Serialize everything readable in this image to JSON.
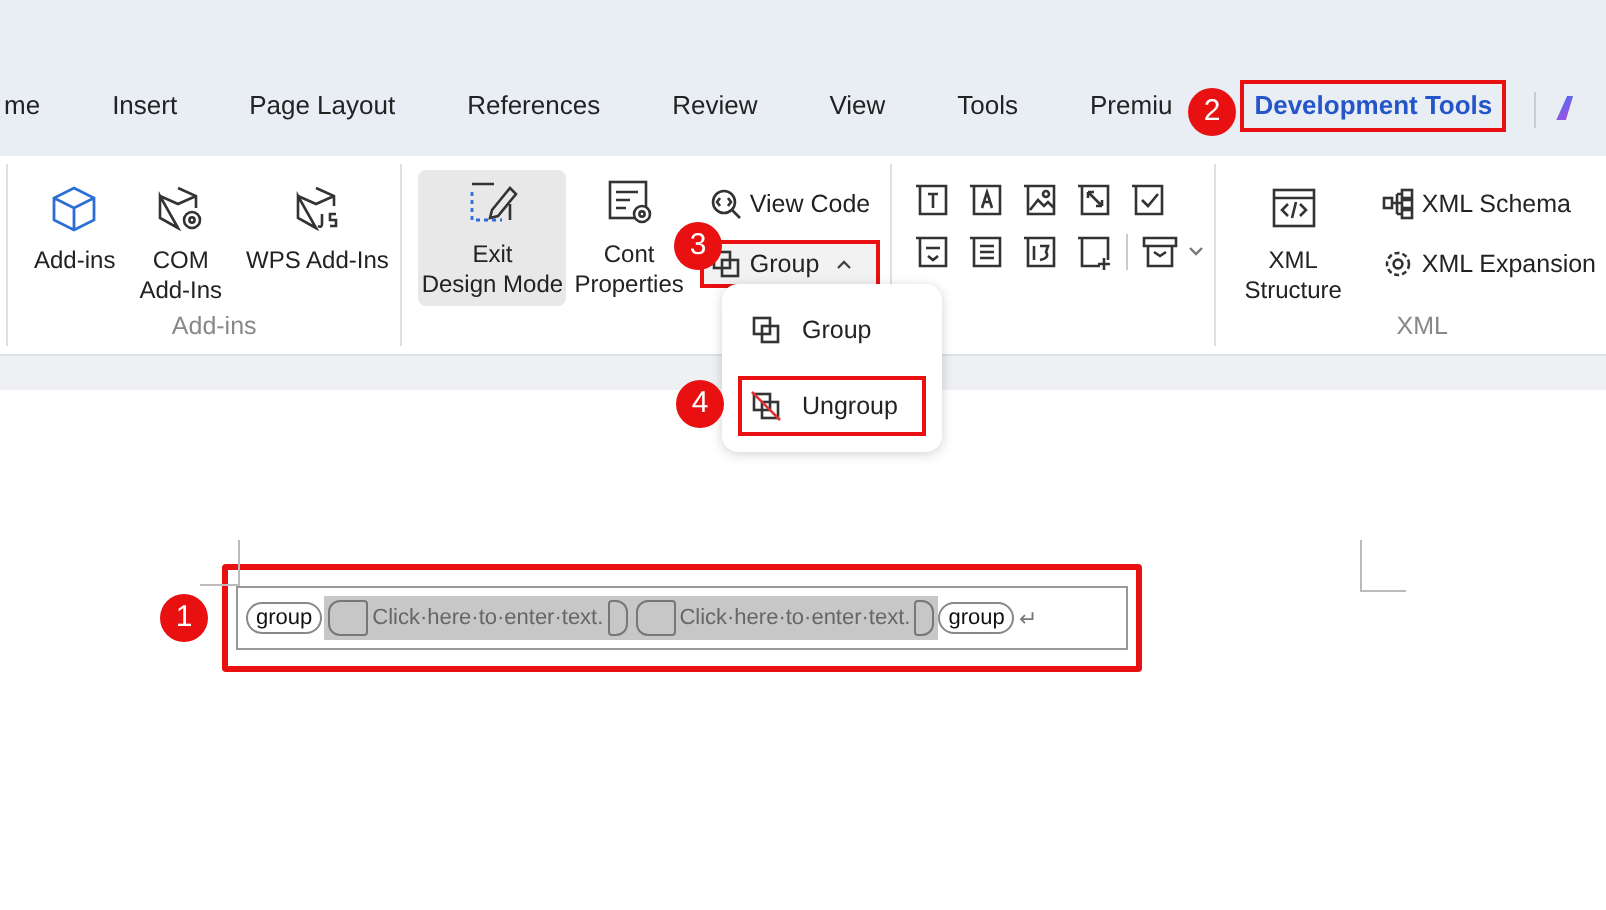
{
  "tabs": [
    {
      "label": "me",
      "selected": false,
      "highlighted": false
    },
    {
      "label": "Insert",
      "selected": false,
      "highlighted": false
    },
    {
      "label": "Page Layout",
      "selected": false,
      "highlighted": false
    },
    {
      "label": "References",
      "selected": false,
      "highlighted": false
    },
    {
      "label": "Review",
      "selected": false,
      "highlighted": false
    },
    {
      "label": "View",
      "selected": false,
      "highlighted": false
    },
    {
      "label": "Tools",
      "selected": false,
      "highlighted": false
    },
    {
      "label": "Premiu",
      "selected": false,
      "highlighted": false
    },
    {
      "label": "Development Tools",
      "selected": true,
      "highlighted": true
    }
  ],
  "ribbon": {
    "groups": [
      {
        "kind": "large",
        "label": "Add-ins",
        "buttons": [
          {
            "lines": [
              "Add-ins"
            ],
            "selected": false
          },
          {
            "lines": [
              "COM",
              "Add-Ins"
            ],
            "selected": false
          },
          {
            "lines": [
              "WPS Add-Ins"
            ],
            "selected": false
          }
        ]
      },
      {
        "kind": "mixed",
        "buttons": [
          {
            "lines": [
              "Exit",
              "Design Mode"
            ],
            "selected": true
          },
          {
            "lines": [
              "Cont",
              "Properties"
            ],
            "selected": false
          }
        ],
        "small": [
          {
            "label": "View Code",
            "expanded": false,
            "highlighted": false
          },
          {
            "label": "Group",
            "expanded": true,
            "highlighted": true
          }
        ]
      },
      {
        "kind": "icons"
      },
      {
        "kind": "mixed",
        "label": "XML",
        "buttons": [
          {
            "lines": [
              "XML",
              "Structure"
            ],
            "selected": false
          }
        ],
        "small": [
          {
            "label": "XML Schema",
            "expanded": false,
            "highlighted": false
          },
          {
            "label": "XML Expansion",
            "expanded": false,
            "highlighted": false
          }
        ]
      }
    ]
  },
  "menu": {
    "items": [
      {
        "label": "Group",
        "highlighted": false
      },
      {
        "label": "Ungroup",
        "highlighted": true
      }
    ]
  },
  "document": {
    "highlighted": true,
    "start_tag": "group",
    "placeholders": [
      "Click·here·to·enter·text.",
      "Click·here·to·enter·text."
    ],
    "end_tag": "group",
    "paragraph_mark": "↵"
  },
  "callouts": [
    {
      "number": "1"
    },
    {
      "number": "2"
    },
    {
      "number": "3"
    },
    {
      "number": "4"
    }
  ]
}
